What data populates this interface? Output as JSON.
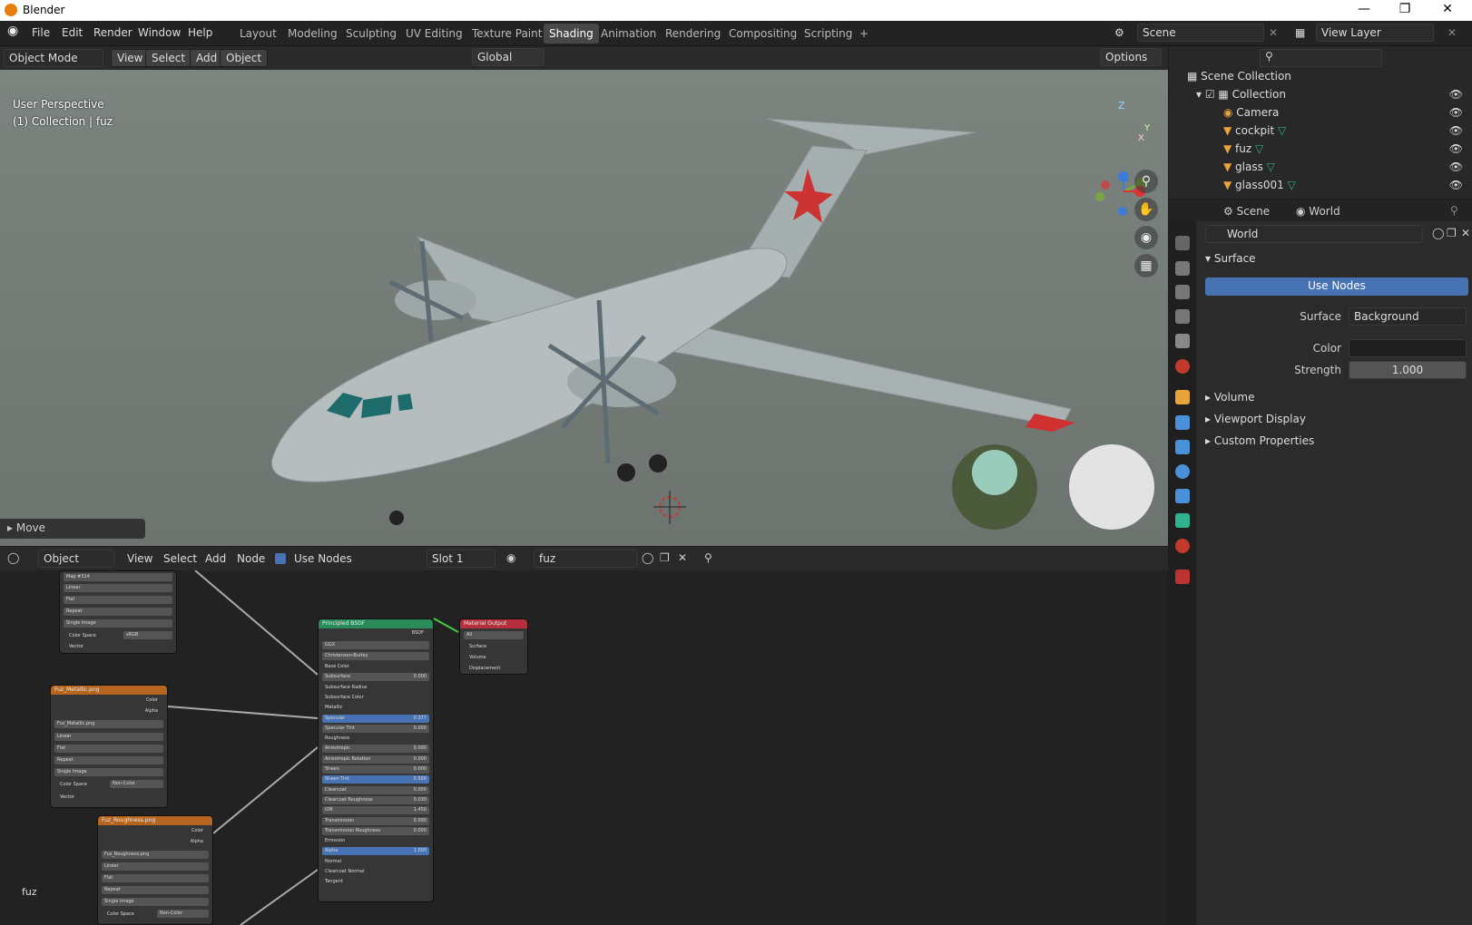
{
  "window": {
    "title": "Blender"
  },
  "menu": [
    "File",
    "Edit",
    "Render",
    "Window",
    "Help"
  ],
  "workspaces": [
    "Layout",
    "Modeling",
    "Sculpting",
    "UV Editing",
    "Texture Paint",
    "Shading",
    "Animation",
    "Rendering",
    "Compositing",
    "Scripting"
  ],
  "active_workspace": "Shading",
  "add_workspace": "+",
  "scene": {
    "name": "Scene",
    "view_layer": "View Layer"
  },
  "viewport": {
    "mode": "Object Mode",
    "menu": [
      "View",
      "Select",
      "Add",
      "Object"
    ],
    "orientation": "Global",
    "options": "Options",
    "perspective": "User Perspective",
    "collection_info": "(1) Collection | fuz",
    "last_op": "Move",
    "gizmo": {
      "z": "Z",
      "y": "Y",
      "x": "X"
    }
  },
  "outliner": {
    "title": "Scene Collection",
    "collection": "Collection",
    "items": [
      "Camera",
      "cockpit",
      "fuz",
      "glass",
      "glass001"
    ]
  },
  "properties": {
    "breadcrumb_scene": "Scene",
    "breadcrumb_world": "World",
    "world_name": "World",
    "surface_panel": "Surface",
    "use_nodes": "Use Nodes",
    "surface_label": "Surface",
    "surface_value": "Background",
    "color_label": "Color",
    "strength_label": "Strength",
    "strength_value": "1.000",
    "collapsed_panels": [
      "Volume",
      "Viewport Display",
      "Custom Properties"
    ]
  },
  "node_editor": {
    "type": "Object",
    "menu": [
      "View",
      "Select",
      "Add",
      "Node"
    ],
    "use_nodes": "Use Nodes",
    "slot": "Slot 1",
    "material": "fuz",
    "object_label": "fuz",
    "principled": {
      "title": "Principled BSDF",
      "out": "BSDF",
      "dist": "GGX",
      "sss": "Christensen-Burley",
      "rows": [
        [
          "Base Color",
          ""
        ],
        [
          "Subsurface",
          "0.000"
        ],
        [
          "Subsurface Radius",
          ""
        ],
        [
          "Subsurface Color",
          ""
        ],
        [
          "Metallic",
          ""
        ],
        [
          "Specular",
          "0.377"
        ],
        [
          "Specular Tint",
          "0.000"
        ],
        [
          "Roughness",
          ""
        ],
        [
          "Anisotropic",
          "0.000"
        ],
        [
          "Anisotropic Rotation",
          "0.000"
        ],
        [
          "Sheen",
          "0.000"
        ],
        [
          "Sheen Tint",
          "0.500"
        ],
        [
          "Clearcoat",
          "0.000"
        ],
        [
          "Clearcoat Roughness",
          "0.030"
        ],
        [
          "IOR",
          "1.450"
        ],
        [
          "Transmission",
          "0.000"
        ],
        [
          "Transmission Roughness",
          "0.000"
        ],
        [
          "Emission",
          ""
        ],
        [
          "Alpha",
          "1.000"
        ],
        [
          "Normal",
          ""
        ],
        [
          "Clearcoat Normal",
          ""
        ],
        [
          "Tangent",
          ""
        ]
      ]
    },
    "output": {
      "title": "Material Output",
      "target": "All",
      "sockets": [
        "Surface",
        "Volume",
        "Displacement"
      ]
    },
    "tex_top": {
      "img": "Map #314",
      "opts": [
        "Linear",
        "Flat",
        "Repeat",
        "Single Image"
      ],
      "cs_label": "Color Space",
      "cs": "sRGB",
      "vector": "Vector"
    },
    "tex_metal": {
      "title": "Fuz_Metallic.png",
      "img": "Fuz_Metallic.png",
      "opts": [
        "Linear",
        "Flat",
        "Repeat",
        "Single Image"
      ],
      "cs_label": "Color Space",
      "cs": "Non-Color",
      "vector": "Vector",
      "color": "Color",
      "alpha": "Alpha"
    },
    "tex_rough": {
      "title": "Fuz_Roughness.png",
      "img": "Fuz_Roughness.png",
      "opts": [
        "Linear",
        "Flat",
        "Repeat",
        "Single Image"
      ],
      "cs_label": "Color Space",
      "cs": "Non-Color",
      "color": "Color",
      "alpha": "Alpha"
    }
  }
}
